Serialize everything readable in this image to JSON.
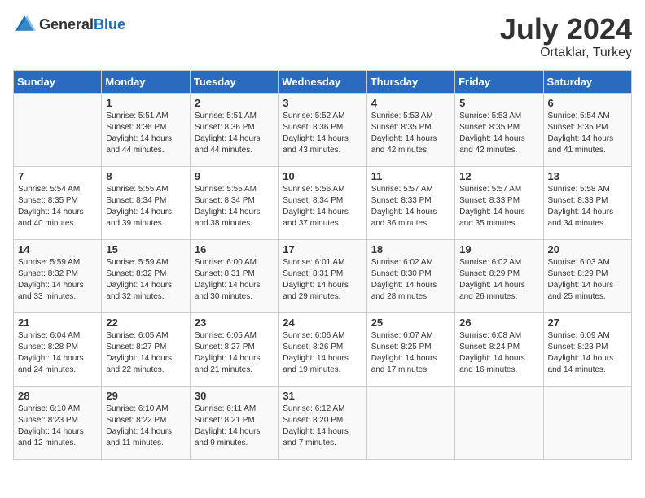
{
  "header": {
    "logo_general": "General",
    "logo_blue": "Blue",
    "month_year": "July 2024",
    "location": "Ortaklar, Turkey"
  },
  "weekdays": [
    "Sunday",
    "Monday",
    "Tuesday",
    "Wednesday",
    "Thursday",
    "Friday",
    "Saturday"
  ],
  "weeks": [
    [
      {
        "date": "",
        "info": ""
      },
      {
        "date": "1",
        "info": "Sunrise: 5:51 AM\nSunset: 8:36 PM\nDaylight: 14 hours\nand 44 minutes."
      },
      {
        "date": "2",
        "info": "Sunrise: 5:51 AM\nSunset: 8:36 PM\nDaylight: 14 hours\nand 44 minutes."
      },
      {
        "date": "3",
        "info": "Sunrise: 5:52 AM\nSunset: 8:36 PM\nDaylight: 14 hours\nand 43 minutes."
      },
      {
        "date": "4",
        "info": "Sunrise: 5:53 AM\nSunset: 8:35 PM\nDaylight: 14 hours\nand 42 minutes."
      },
      {
        "date": "5",
        "info": "Sunrise: 5:53 AM\nSunset: 8:35 PM\nDaylight: 14 hours\nand 42 minutes."
      },
      {
        "date": "6",
        "info": "Sunrise: 5:54 AM\nSunset: 8:35 PM\nDaylight: 14 hours\nand 41 minutes."
      }
    ],
    [
      {
        "date": "7",
        "info": "Sunrise: 5:54 AM\nSunset: 8:35 PM\nDaylight: 14 hours\nand 40 minutes."
      },
      {
        "date": "8",
        "info": "Sunrise: 5:55 AM\nSunset: 8:34 PM\nDaylight: 14 hours\nand 39 minutes."
      },
      {
        "date": "9",
        "info": "Sunrise: 5:55 AM\nSunset: 8:34 PM\nDaylight: 14 hours\nand 38 minutes."
      },
      {
        "date": "10",
        "info": "Sunrise: 5:56 AM\nSunset: 8:34 PM\nDaylight: 14 hours\nand 37 minutes."
      },
      {
        "date": "11",
        "info": "Sunrise: 5:57 AM\nSunset: 8:33 PM\nDaylight: 14 hours\nand 36 minutes."
      },
      {
        "date": "12",
        "info": "Sunrise: 5:57 AM\nSunset: 8:33 PM\nDaylight: 14 hours\nand 35 minutes."
      },
      {
        "date": "13",
        "info": "Sunrise: 5:58 AM\nSunset: 8:33 PM\nDaylight: 14 hours\nand 34 minutes."
      }
    ],
    [
      {
        "date": "14",
        "info": "Sunrise: 5:59 AM\nSunset: 8:32 PM\nDaylight: 14 hours\nand 33 minutes."
      },
      {
        "date": "15",
        "info": "Sunrise: 5:59 AM\nSunset: 8:32 PM\nDaylight: 14 hours\nand 32 minutes."
      },
      {
        "date": "16",
        "info": "Sunrise: 6:00 AM\nSunset: 8:31 PM\nDaylight: 14 hours\nand 30 minutes."
      },
      {
        "date": "17",
        "info": "Sunrise: 6:01 AM\nSunset: 8:31 PM\nDaylight: 14 hours\nand 29 minutes."
      },
      {
        "date": "18",
        "info": "Sunrise: 6:02 AM\nSunset: 8:30 PM\nDaylight: 14 hours\nand 28 minutes."
      },
      {
        "date": "19",
        "info": "Sunrise: 6:02 AM\nSunset: 8:29 PM\nDaylight: 14 hours\nand 26 minutes."
      },
      {
        "date": "20",
        "info": "Sunrise: 6:03 AM\nSunset: 8:29 PM\nDaylight: 14 hours\nand 25 minutes."
      }
    ],
    [
      {
        "date": "21",
        "info": "Sunrise: 6:04 AM\nSunset: 8:28 PM\nDaylight: 14 hours\nand 24 minutes."
      },
      {
        "date": "22",
        "info": "Sunrise: 6:05 AM\nSunset: 8:27 PM\nDaylight: 14 hours\nand 22 minutes."
      },
      {
        "date": "23",
        "info": "Sunrise: 6:05 AM\nSunset: 8:27 PM\nDaylight: 14 hours\nand 21 minutes."
      },
      {
        "date": "24",
        "info": "Sunrise: 6:06 AM\nSunset: 8:26 PM\nDaylight: 14 hours\nand 19 minutes."
      },
      {
        "date": "25",
        "info": "Sunrise: 6:07 AM\nSunset: 8:25 PM\nDaylight: 14 hours\nand 17 minutes."
      },
      {
        "date": "26",
        "info": "Sunrise: 6:08 AM\nSunset: 8:24 PM\nDaylight: 14 hours\nand 16 minutes."
      },
      {
        "date": "27",
        "info": "Sunrise: 6:09 AM\nSunset: 8:23 PM\nDaylight: 14 hours\nand 14 minutes."
      }
    ],
    [
      {
        "date": "28",
        "info": "Sunrise: 6:10 AM\nSunset: 8:23 PM\nDaylight: 14 hours\nand 12 minutes."
      },
      {
        "date": "29",
        "info": "Sunrise: 6:10 AM\nSunset: 8:22 PM\nDaylight: 14 hours\nand 11 minutes."
      },
      {
        "date": "30",
        "info": "Sunrise: 6:11 AM\nSunset: 8:21 PM\nDaylight: 14 hours\nand 9 minutes."
      },
      {
        "date": "31",
        "info": "Sunrise: 6:12 AM\nSunset: 8:20 PM\nDaylight: 14 hours\nand 7 minutes."
      },
      {
        "date": "",
        "info": ""
      },
      {
        "date": "",
        "info": ""
      },
      {
        "date": "",
        "info": ""
      }
    ]
  ]
}
